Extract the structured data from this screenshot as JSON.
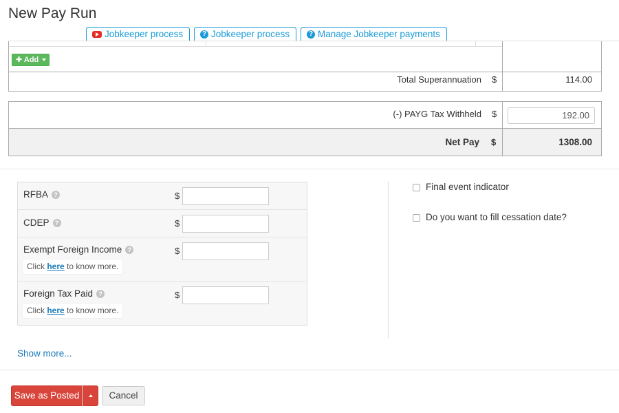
{
  "page": {
    "title": "New Pay Run"
  },
  "tabs": [
    {
      "label": "Jobkeeper process",
      "icon": "youtube-icon"
    },
    {
      "label": "Jobkeeper process",
      "icon": "question-circle-icon"
    },
    {
      "label": "Manage Jobkeeper payments",
      "icon": "question-circle-icon"
    }
  ],
  "super": {
    "add_label": "Add"
  },
  "totals": {
    "total_super_label": "Total Superannuation",
    "total_super_value": "114.00",
    "payg_label": "(-) PAYG Tax Withheld",
    "payg_value": "192.00",
    "net_pay_label": "Net Pay",
    "net_pay_value": "1308.00",
    "currency": "$"
  },
  "fields": [
    {
      "label": "RFBA",
      "value": ""
    },
    {
      "label": "CDEP",
      "value": ""
    },
    {
      "label": "Exempt Foreign Income",
      "value": "",
      "help_prefix": "Click",
      "help_link": "here",
      "help_suffix": "to know more."
    },
    {
      "label": "Foreign Tax Paid",
      "value": "",
      "help_prefix": "Click",
      "help_link": "here",
      "help_suffix": "to know more."
    }
  ],
  "options": {
    "final_event": {
      "label": "Final event indicator",
      "checked": false
    },
    "cessation": {
      "label": "Do you want to fill cessation date?",
      "checked": false
    }
  },
  "show_more": "Show more...",
  "actions": {
    "save_label": "Save as Posted",
    "cancel_label": "Cancel"
  },
  "colors": {
    "accent": "#1a9bd7",
    "save": "#d9453b",
    "add": "#5cb85c"
  }
}
